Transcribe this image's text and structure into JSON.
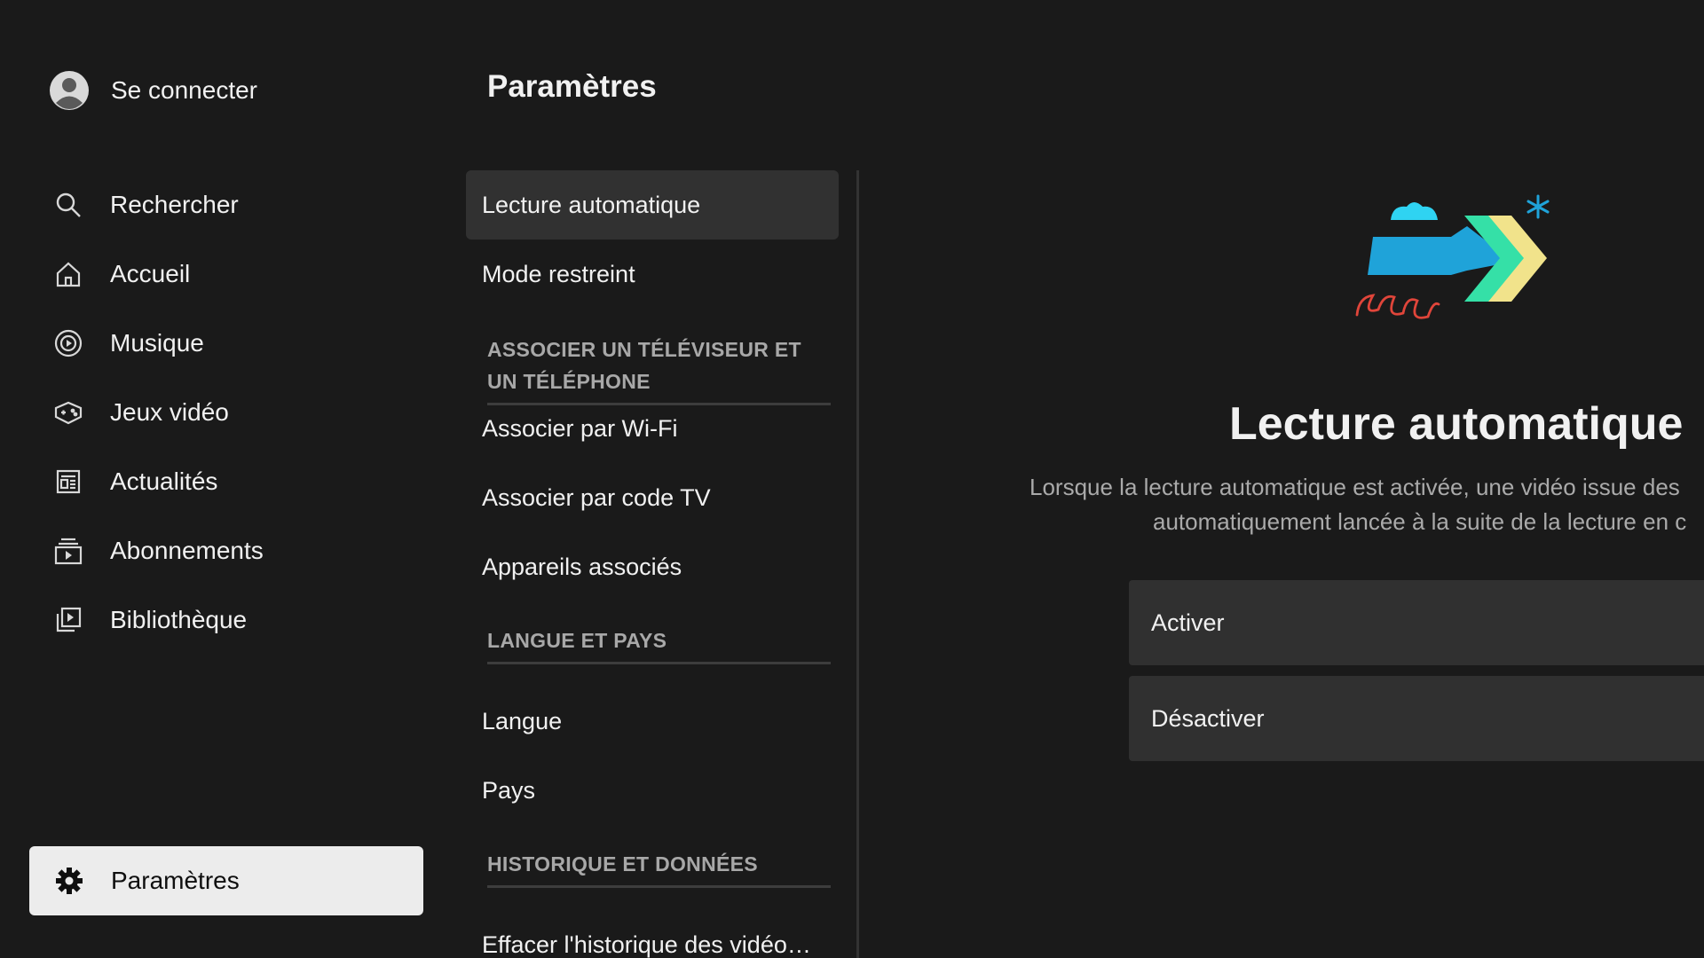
{
  "sidebar": {
    "sign_in": {
      "label": "Se connecter",
      "icon": "account-circle-icon"
    },
    "items": [
      {
        "label": "Rechercher",
        "icon": "search-icon"
      },
      {
        "label": "Accueil",
        "icon": "home-icon"
      },
      {
        "label": "Musique",
        "icon": "music-icon"
      },
      {
        "label": "Jeux vidéo",
        "icon": "gamepad-icon"
      },
      {
        "label": "Actualités",
        "icon": "news-icon"
      },
      {
        "label": "Abonnements",
        "icon": "subscriptions-icon"
      },
      {
        "label": "Bibliothèque",
        "icon": "library-icon"
      }
    ],
    "settings": {
      "label": "Paramètres",
      "icon": "gear-icon"
    }
  },
  "settings_menu": {
    "title": "Paramètres",
    "items": {
      "autoplay": "Lecture automatique",
      "restricted": "Mode restreint",
      "pair_section": "ASSOCIER UN TÉLÉVISEUR ET UN TÉLÉPHONE",
      "pair_wifi": "Associer par Wi-Fi",
      "pair_tv_code": "Associer par code TV",
      "linked_devices": "Appareils associés",
      "lang_section": "LANGUE ET PAYS",
      "language": "Langue",
      "country": "Pays",
      "history_section": "HISTORIQUE ET DONNÉES",
      "clear_history": "Effacer l'historique des vidéo…"
    },
    "selected": "Lecture automatique"
  },
  "detail": {
    "illustration": "autoplay-arrow-illustration",
    "title": "Lecture automatique",
    "description_line1": "Lorsque la lecture automatique est activée, une vidéo issue des",
    "description_line2": "automatiquement lancée à la suite de la lecture en c",
    "options": {
      "enable": "Activer",
      "disable": "Désactiver"
    }
  },
  "colors": {
    "background": "#1a1a1a",
    "selected_menu": "#313131",
    "selected_nav": "#ececec",
    "option_bg": "#303030",
    "section_head": "#a8a8a8",
    "illustration_blue": "#1fa3d9",
    "illustration_cyan": "#2fd3f2",
    "illustration_green": "#35e0a7",
    "illustration_yellow": "#f1e38b",
    "illustration_red": "#e0453a"
  }
}
